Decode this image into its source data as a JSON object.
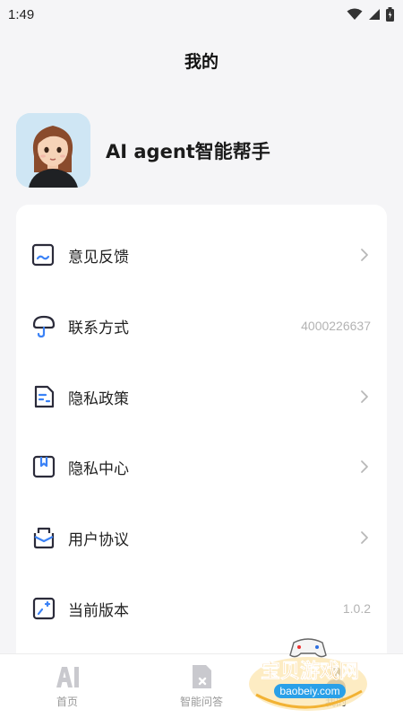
{
  "status_bar": {
    "time": "1:49",
    "icons": [
      "wifi-icon",
      "signal-icon",
      "battery-icon"
    ]
  },
  "header": {
    "title": "我的"
  },
  "profile": {
    "name": "AI agent智能帮手",
    "avatar": "avatar-girl"
  },
  "menu": {
    "items": [
      {
        "label": "意见反馈",
        "icon": "feedback-icon",
        "chevron": true
      },
      {
        "label": "联系方式",
        "icon": "contact-icon",
        "value": "4000226637"
      },
      {
        "label": "隐私政策",
        "icon": "policy-icon",
        "chevron": true
      },
      {
        "label": "隐私中心",
        "icon": "bookmark-icon",
        "chevron": true
      },
      {
        "label": "用户协议",
        "icon": "agreement-icon",
        "chevron": true
      },
      {
        "label": "当前版本",
        "icon": "version-icon",
        "value": "1.0.2"
      }
    ]
  },
  "bottom_nav": {
    "items": [
      {
        "label": "首页",
        "icon": "ai-home-icon"
      },
      {
        "label": "智能问答",
        "icon": "qa-doc-icon"
      },
      {
        "label": "我的",
        "icon": "profile-icon",
        "active": true
      }
    ]
  },
  "watermark": {
    "text": "宝贝游戏网",
    "url": "baobeiy.com"
  },
  "colors": {
    "background": "#f5f5f7",
    "card": "#ffffff",
    "icon_stroke": "#2b2b3a",
    "icon_accent": "#3b82f6",
    "muted": "#b3b3b3"
  }
}
